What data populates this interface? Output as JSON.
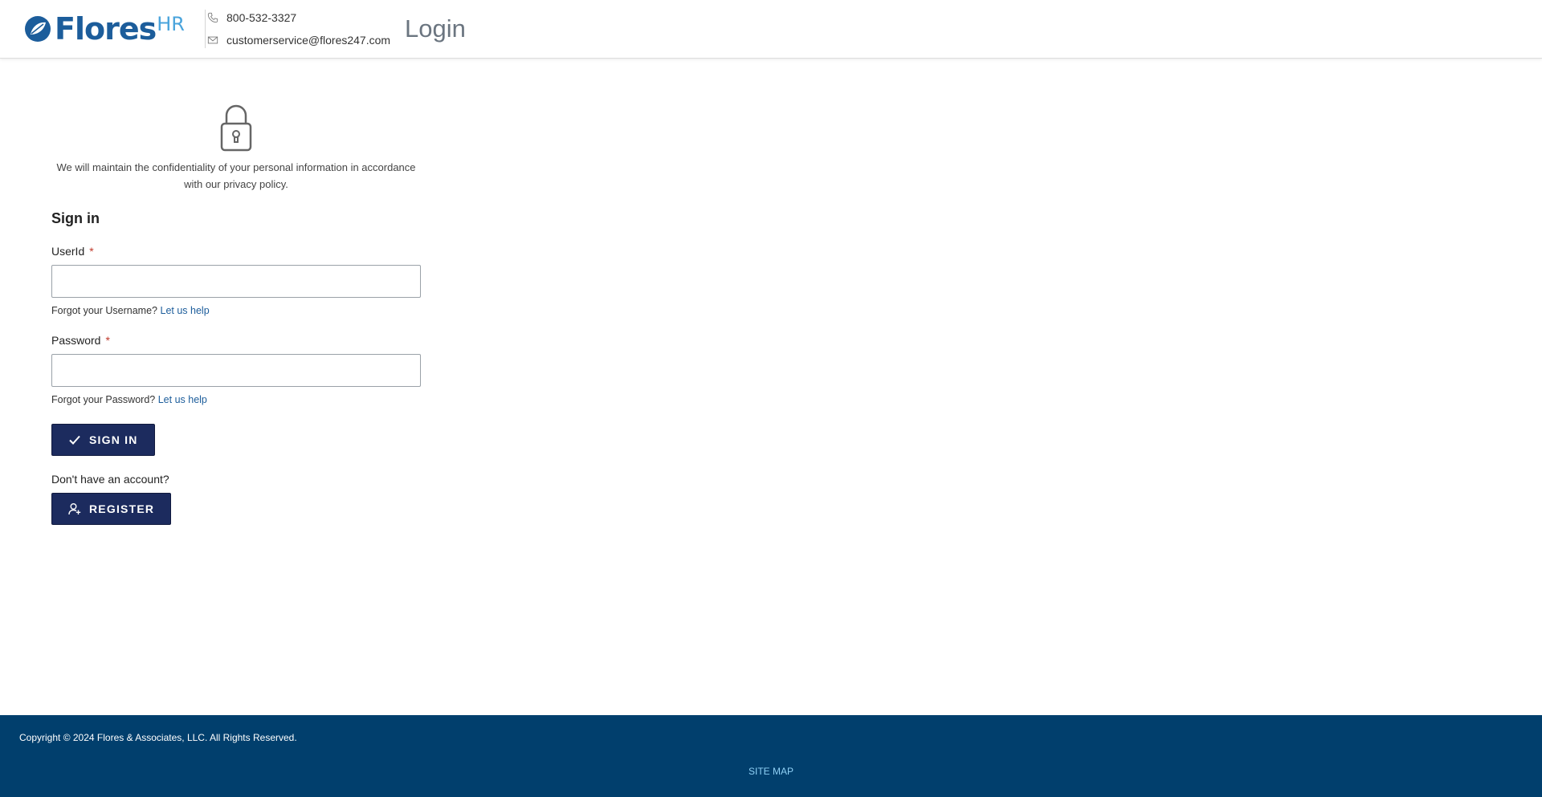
{
  "header": {
    "logo": {
      "name": "Flores",
      "suffix": "HR"
    },
    "phone": "800-532-3327",
    "email": "customerservice@flores247.com",
    "page_title": "Login"
  },
  "main": {
    "privacy_text": "We will maintain the confidentiality of your personal information in accordance with our privacy policy.",
    "signin_heading": "Sign in",
    "userid": {
      "label": "UserId",
      "required_mark": "*",
      "value": "",
      "help_text": "Forgot your Username?",
      "help_link": "Let us help"
    },
    "password": {
      "label": "Password",
      "required_mark": "*",
      "value": "",
      "help_text": "Forgot your Password?",
      "help_link": "Let us help"
    },
    "signin_button": "SIGN IN",
    "no_account_text": "Don't have an account?",
    "register_button": "REGISTER"
  },
  "footer": {
    "copyright": "Copyright © 2024 Flores & Associates, LLC. All Rights Reserved.",
    "sitemap": "SITE MAP"
  },
  "colors": {
    "brand_blue": "#1c5d9b",
    "brand_light_blue": "#4aa4dc",
    "button_navy": "#1c2b5e",
    "footer_bg": "#013f6d",
    "required_red": "#c0392b"
  },
  "icons": [
    "flores-leaf-logo-icon",
    "phone-icon",
    "mail-icon",
    "lock-icon",
    "checkmark-icon",
    "add-user-icon"
  ]
}
